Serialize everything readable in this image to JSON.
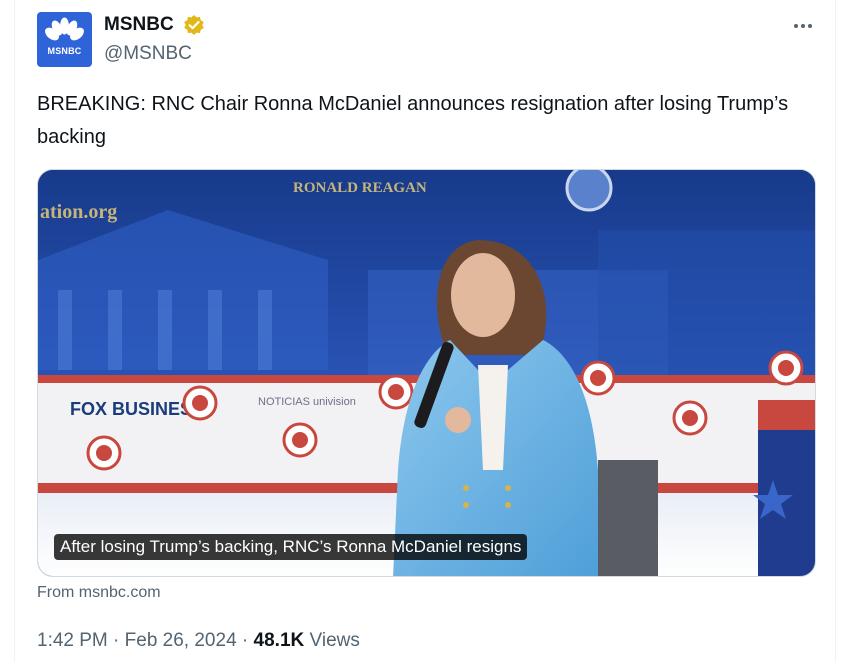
{
  "account": {
    "name": "MSNBC",
    "handle": "@MSNBC",
    "avatar_text": "MSNBC",
    "verified_color": "#e2b719"
  },
  "tweet": {
    "text": "BREAKING: RNC Chair Ronna McDaniel announces resignation after losing Trump’s backing"
  },
  "media": {
    "caption": "After losing Trump’s backing, RNC’s Ronna McDaniel resigns",
    "background_text_left": "ation.org",
    "background_text_top": "RONALD REAGAN",
    "sponsor_logo": "FOX BUSINESS",
    "univision_logo": "NOTICIAS univision"
  },
  "card": {
    "source": "From msnbc.com"
  },
  "meta": {
    "time": "1:42 PM",
    "separator": "·",
    "date": "Feb 26, 2024",
    "views_count": "48.1K",
    "views_label": "Views"
  },
  "colors": {
    "brand_blue": "#2f63d8",
    "text_primary": "#0f1419",
    "text_secondary": "#536471"
  },
  "icons": [
    "msnbc-peacock-icon",
    "verified-badge-icon",
    "more-options-icon"
  ]
}
